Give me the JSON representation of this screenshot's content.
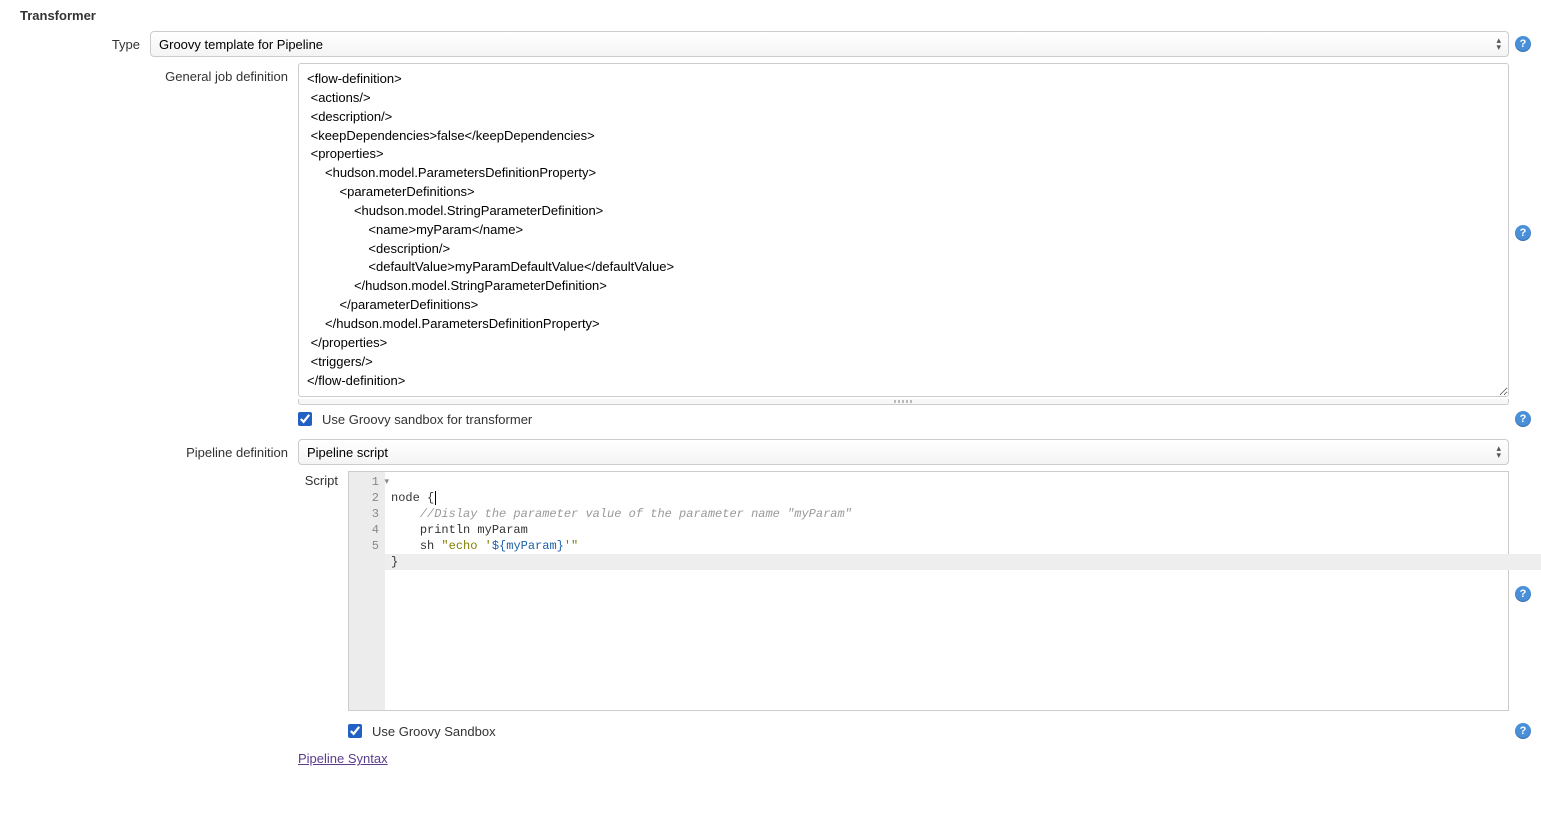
{
  "section": {
    "title": "Transformer"
  },
  "type": {
    "label": "Type",
    "selected": "Groovy template for Pipeline"
  },
  "general_job": {
    "label": "General job definition",
    "xml": "<flow-definition>\n <actions/>\n <description/>\n <keepDependencies>false</keepDependencies>\n <properties>\n     <hudson.model.ParametersDefinitionProperty>\n         <parameterDefinitions>\n             <hudson.model.StringParameterDefinition>\n                 <name>myParam</name>\n                 <description/>\n                 <defaultValue>myParamDefaultValue</defaultValue>\n             </hudson.model.StringParameterDefinition>\n         </parameterDefinitions>\n     </hudson.model.ParametersDefinitionProperty>\n </properties>\n <triggers/>\n</flow-definition>"
  },
  "sandbox_transformer": {
    "checked": true,
    "label": "Use Groovy sandbox for transformer"
  },
  "pipeline_def": {
    "label": "Pipeline definition",
    "selected": "Pipeline script"
  },
  "script": {
    "label": "Script",
    "lines": {
      "l1": "node {",
      "l2_indent": "    ",
      "l2_comment": "//Dislay the parameter value of the parameter name \"myParam\"",
      "l3_indent": "    ",
      "l3_text": "println myParam",
      "l4_indent": "    ",
      "l4_sh": "sh ",
      "l4_str_open": "\"echo '",
      "l4_tmpl": "${myParam}",
      "l4_str_close": "'\"",
      "l5": "}"
    },
    "line_numbers": {
      "n1": "1",
      "n2": "2",
      "n3": "3",
      "n4": "4",
      "n5": "5"
    }
  },
  "sandbox_script": {
    "checked": true,
    "label": "Use Groovy Sandbox"
  },
  "pipeline_syntax_link": "Pipeline Syntax"
}
